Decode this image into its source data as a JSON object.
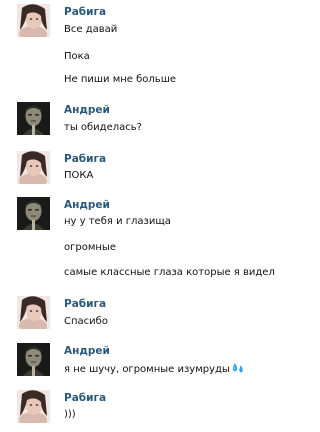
{
  "colors": {
    "sender_name": "#2b587a",
    "message_text": "#111111",
    "background": "#ffffff"
  },
  "messages": [
    {
      "sender": "Рабига",
      "avatar": "rabiga-avatar",
      "lines": [
        "Все давай",
        "Пока",
        "Не пиши мне больше"
      ]
    },
    {
      "sender": "Андрей",
      "avatar": "andrey-avatar",
      "lines": [
        "ты обиделась?"
      ]
    },
    {
      "sender": "Рабига",
      "avatar": "rabiga-avatar",
      "lines": [
        "ПОКА"
      ]
    },
    {
      "sender": "Андрей",
      "avatar": "andrey-avatar",
      "lines": [
        "ну у тебя и глазища",
        "огромные",
        "самые классные глаза которые я видел"
      ]
    },
    {
      "sender": "Рабига",
      "avatar": "rabiga-avatar",
      "lines": [
        "Спасибо"
      ]
    },
    {
      "sender": "Андрей",
      "avatar": "andrey-avatar",
      "lines": [
        "я не шучу, огромные изумруды"
      ],
      "emoji": "sweat-droplets-icon"
    },
    {
      "sender": "Рабига",
      "avatar": "rabiga-avatar",
      "lines": [
        ")))"
      ]
    }
  ]
}
